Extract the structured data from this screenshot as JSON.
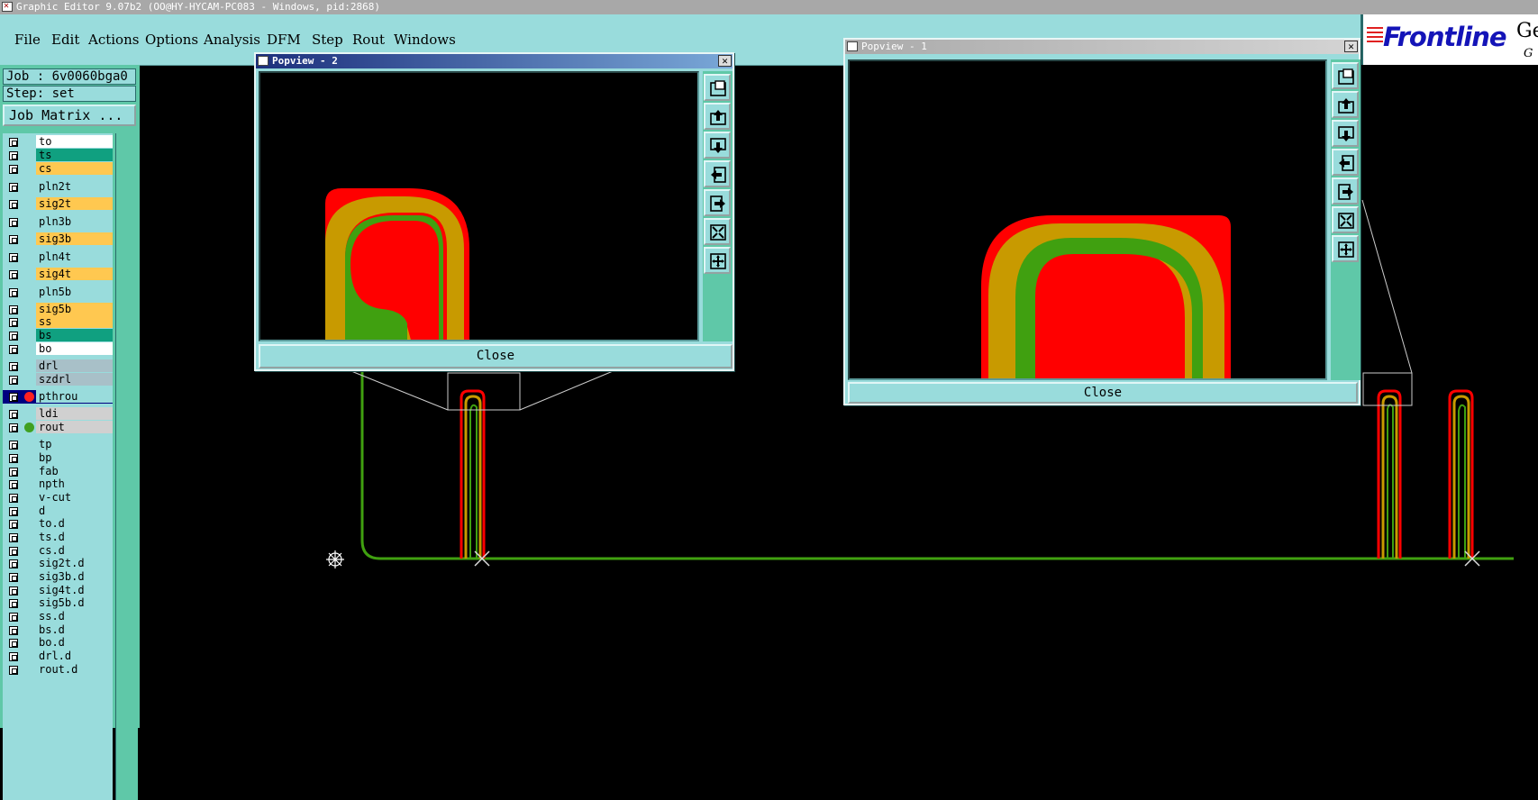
{
  "app_title": "Graphic Editor 9.07b2 (OO@HY-HYCAM-PC083 - Windows, pid:2868)",
  "menu": [
    {
      "label": "File"
    },
    {
      "label": "Edit"
    },
    {
      "label": "Actions"
    },
    {
      "label": "Options"
    },
    {
      "label": "Analysis"
    },
    {
      "label": "DFM"
    },
    {
      "label": "Step"
    },
    {
      "label": "Rout"
    },
    {
      "label": "Windows"
    }
  ],
  "logo": {
    "brand": "Frontline",
    "suffix": "Ge",
    "sub": "G"
  },
  "job": {
    "job_label": "Job : 6v0060bga0",
    "step_label": "Step: set",
    "matrix_button": "Job Matrix ..."
  },
  "layers": [
    {
      "name": "to",
      "color": "#ffffff"
    },
    {
      "name": "ts",
      "color": "#10a080"
    },
    {
      "name": "cs",
      "color": "#ffc850"
    },
    {
      "name": "pln2t",
      "color": "#99dcdc"
    },
    {
      "name": "sig2t",
      "color": "#ffc850"
    },
    {
      "name": "pln3b",
      "color": "#99dcdc"
    },
    {
      "name": "sig3b",
      "color": "#ffc850"
    },
    {
      "name": "pln4t",
      "color": "#99dcdc"
    },
    {
      "name": "sig4t",
      "color": "#ffc850"
    },
    {
      "name": "pln5b",
      "color": "#99dcdc"
    },
    {
      "name": "sig5b",
      "color": "#ffc850"
    },
    {
      "name": "ss",
      "color": "#ffc850"
    },
    {
      "name": "bs",
      "color": "#10a080"
    },
    {
      "name": "bo",
      "color": "#ffffff"
    },
    {
      "name": "drl",
      "color": "#a8c0c8"
    },
    {
      "name": "szdrl",
      "color": "#a8c0c8"
    },
    {
      "name": "pthrou",
      "color": "#99dcdc",
      "dot": "#ff2020",
      "active": true
    },
    {
      "name": "ldi",
      "color": "#d0d0d0"
    },
    {
      "name": "rout",
      "color": "#d0d0d0",
      "dot": "#40a020"
    },
    {
      "name": "tp",
      "color": "#99dcdc"
    },
    {
      "name": "bp",
      "color": "#99dcdc"
    },
    {
      "name": "fab",
      "color": "#99dcdc"
    },
    {
      "name": "npth",
      "color": "#99dcdc"
    },
    {
      "name": "v-cut",
      "color": "#99dcdc"
    },
    {
      "name": "d",
      "color": "#99dcdc"
    },
    {
      "name": "to.d",
      "color": "#99dcdc"
    },
    {
      "name": "ts.d",
      "color": "#99dcdc"
    },
    {
      "name": "cs.d",
      "color": "#99dcdc"
    },
    {
      "name": "sig2t.d",
      "color": "#99dcdc"
    },
    {
      "name": "sig3b.d",
      "color": "#99dcdc"
    },
    {
      "name": "sig4t.d",
      "color": "#99dcdc"
    },
    {
      "name": "sig5b.d",
      "color": "#99dcdc"
    },
    {
      "name": "ss.d",
      "color": "#99dcdc"
    },
    {
      "name": "bs.d",
      "color": "#99dcdc"
    },
    {
      "name": "bo.d",
      "color": "#99dcdc"
    },
    {
      "name": "drl.d",
      "color": "#99dcdc"
    },
    {
      "name": "rout.d",
      "color": "#99dcdc"
    }
  ],
  "popview2": {
    "title": "Popview - 2",
    "close_label": "Close"
  },
  "popview1": {
    "title": "Popview - 1",
    "close_label": "Close"
  },
  "popview_tools": [
    "zoom-fit-icon",
    "pan-up-icon",
    "pan-down-icon",
    "pan-left-icon",
    "pan-right-icon",
    "zoom-out-icon",
    "zoom-in-icon"
  ],
  "colors": {
    "pad_red": "#ff0000",
    "trace_orange": "#c89a00",
    "trace_green": "#40a010",
    "ui_teal": "#99dcdc",
    "ui_dark_teal": "#5fc8a8"
  }
}
